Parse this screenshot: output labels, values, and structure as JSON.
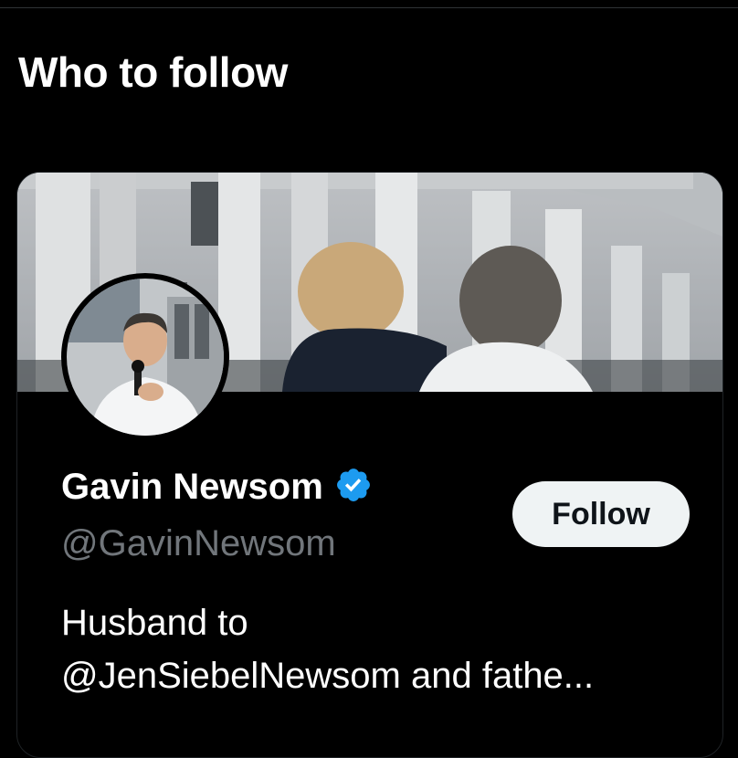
{
  "section": {
    "title": "Who to follow"
  },
  "profile": {
    "name": "Gavin Newsom",
    "handle": "@GavinNewsom",
    "verified": true,
    "bio_line1": "Husband to",
    "bio_line2": "@JenSiebelNewsom and fathe...",
    "follow_label": "Follow"
  },
  "icons": {
    "verified": "verified-badge-icon"
  },
  "colors": {
    "background": "#000000",
    "verified_blue": "#1d9bf0",
    "handle_gray": "#71767b",
    "button_bg": "#eff3f4"
  }
}
